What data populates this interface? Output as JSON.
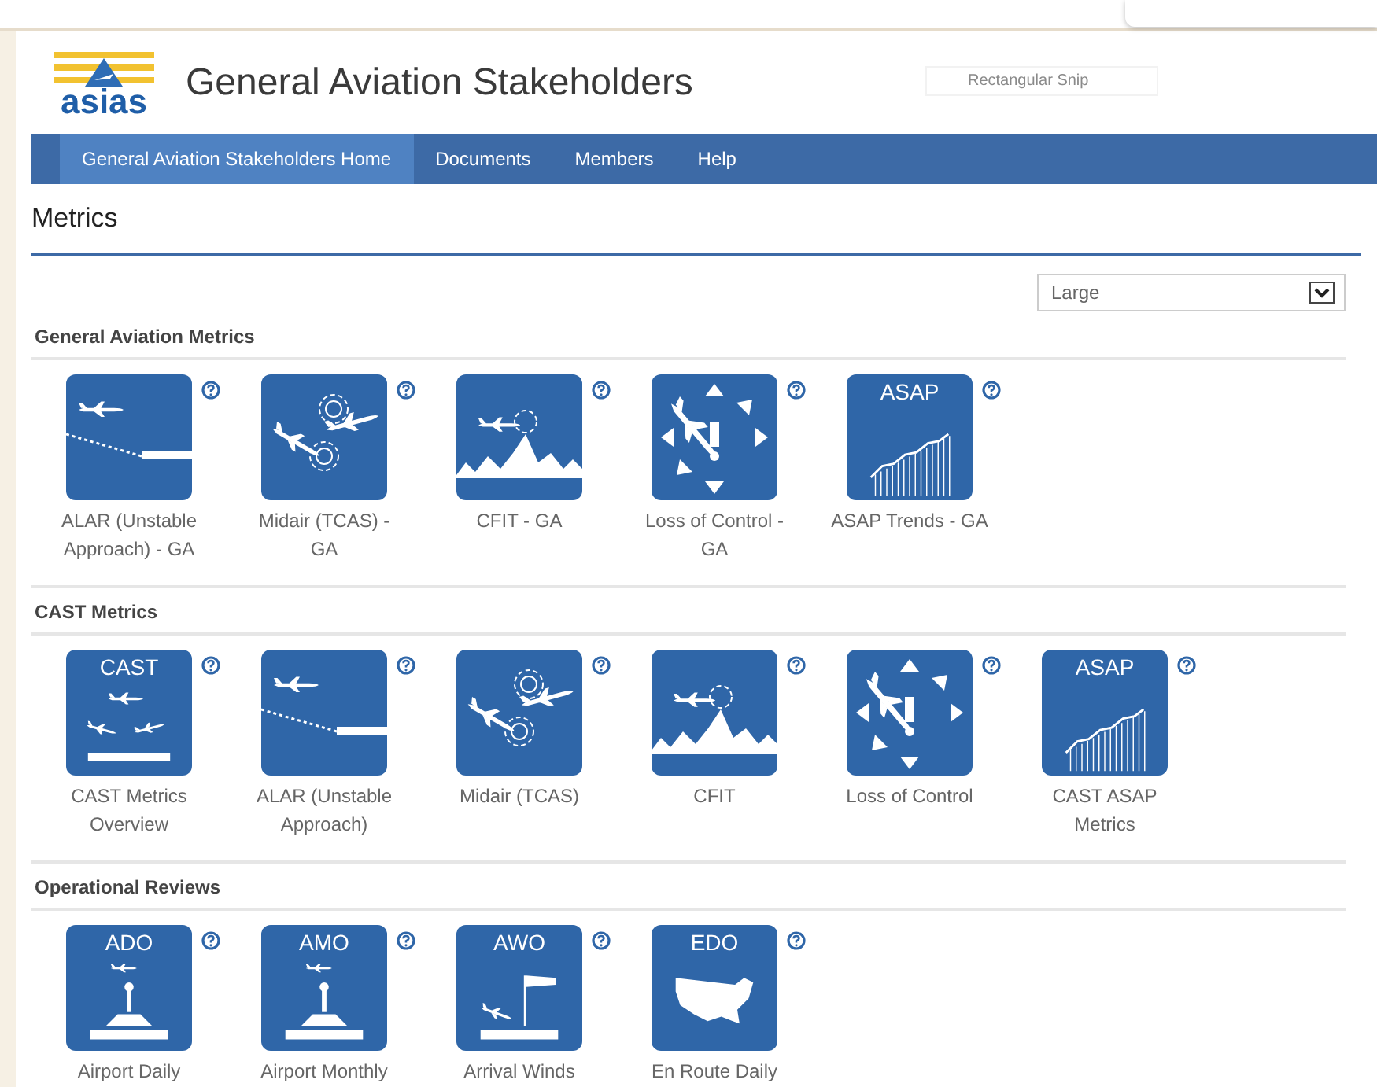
{
  "snip_overlay": {
    "text": "Rectangular Snip"
  },
  "header": {
    "logo_text": "asias",
    "title": "General Aviation Stakeholders"
  },
  "nav": [
    {
      "label": "General Aviation Stakeholders Home",
      "selected": true
    },
    {
      "label": "Documents",
      "selected": false
    },
    {
      "label": "Members",
      "selected": false
    },
    {
      "label": "Help",
      "selected": false
    }
  ],
  "page_title": "Metrics",
  "size_select": {
    "value": "Large"
  },
  "sections": [
    {
      "title": "General Aviation Metrics",
      "tiles": [
        {
          "kind": "approach",
          "label": "ALAR (Unstable Approach) - GA"
        },
        {
          "kind": "midair",
          "label": "Midair (TCAS) - GA"
        },
        {
          "kind": "cfit",
          "label": "CFIT - GA"
        },
        {
          "kind": "loss",
          "label": "Loss of Control - GA"
        },
        {
          "kind": "asap",
          "badge": "ASAP",
          "label": "ASAP Trends - GA"
        }
      ]
    },
    {
      "title": "CAST Metrics",
      "tiles": [
        {
          "kind": "cast",
          "badge": "CAST",
          "label": "CAST Metrics Overview"
        },
        {
          "kind": "approach",
          "label": "ALAR (Unstable Approach)"
        },
        {
          "kind": "midair",
          "label": "Midair (TCAS)"
        },
        {
          "kind": "cfit",
          "label": "CFIT"
        },
        {
          "kind": "loss",
          "label": "Loss of Control"
        },
        {
          "kind": "asap",
          "badge": "ASAP",
          "label": "CAST ASAP Metrics"
        }
      ]
    },
    {
      "title": "Operational Reviews",
      "tiles": [
        {
          "kind": "airport",
          "badge": "ADO",
          "label": "Airport Daily"
        },
        {
          "kind": "airport",
          "badge": "AMO",
          "label": "Airport Monthly"
        },
        {
          "kind": "winds",
          "badge": "AWO",
          "label": "Arrival Winds"
        },
        {
          "kind": "map",
          "badge": "EDO",
          "label": "En Route Daily"
        }
      ]
    }
  ]
}
